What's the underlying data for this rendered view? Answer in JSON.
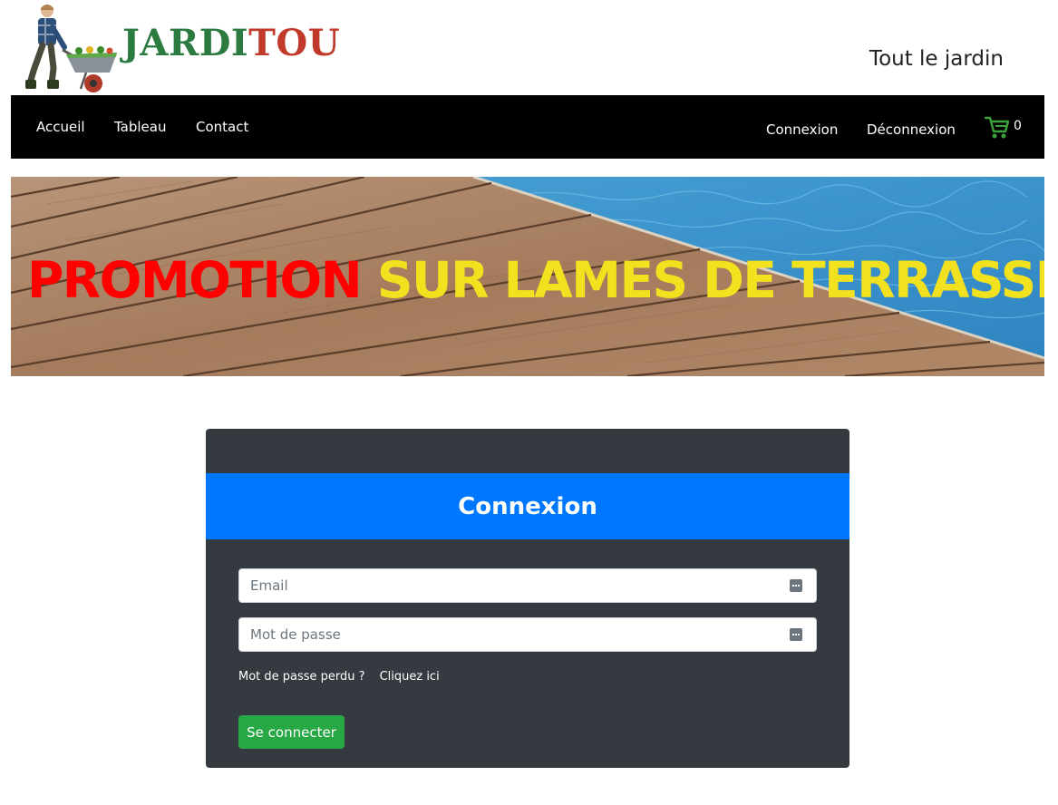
{
  "brand": {
    "name_part1": "JARDI",
    "name_part2": "TOU",
    "logo_icon": "gardener-wheelbarrow-icon"
  },
  "tagline": "Tout le jardin",
  "nav": {
    "left": [
      {
        "label": "Accueil"
      },
      {
        "label": "Tableau"
      },
      {
        "label": "Contact"
      }
    ],
    "right": [
      {
        "label": "Connexion"
      },
      {
        "label": "Déconnexion"
      }
    ],
    "cart": {
      "icon": "shopping-cart-icon",
      "count": "0"
    }
  },
  "banner": {
    "text_red": "PROMOTION",
    "text_yellow": "SUR LAMES DE TERRASSE"
  },
  "login": {
    "title": "Connexion",
    "email_placeholder": "Email",
    "password_placeholder": "Mot de passe",
    "lost_password_text": "Mot de passe perdu ?",
    "lost_password_link": "Cliquez ici",
    "submit_label": "Se connecter"
  },
  "colors": {
    "navbar": "#000000",
    "card": "#343a40",
    "card_header": "#0077ff",
    "submit": "#28a745",
    "brand_green": "#2b7a3f",
    "brand_red": "#c0392b",
    "banner_red": "#ff0000",
    "banner_yellow": "#f2e11e"
  }
}
